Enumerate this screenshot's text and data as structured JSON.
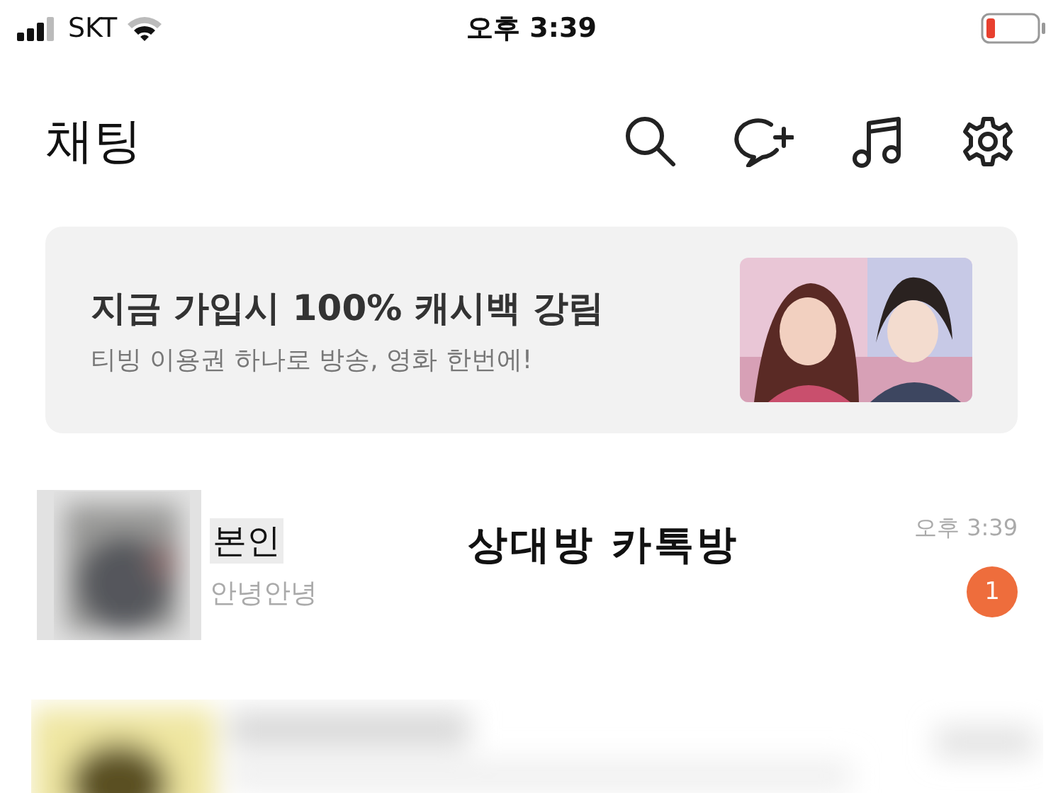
{
  "status_bar": {
    "carrier": "SKT",
    "time": "오후 3:39"
  },
  "header": {
    "title": "채팅"
  },
  "banner": {
    "headline": "지금 가입시 100% 캐시백 강림",
    "subline": "티빙 이용권 하나로 방송, 영화 한번에!"
  },
  "chats": [
    {
      "kind": "chat",
      "name": "본인",
      "preview": "안녕안녕",
      "time": "오후 3:39",
      "unread": "1"
    },
    {
      "kind": "blurred"
    }
  ],
  "annotation": "상대방 카톡방"
}
